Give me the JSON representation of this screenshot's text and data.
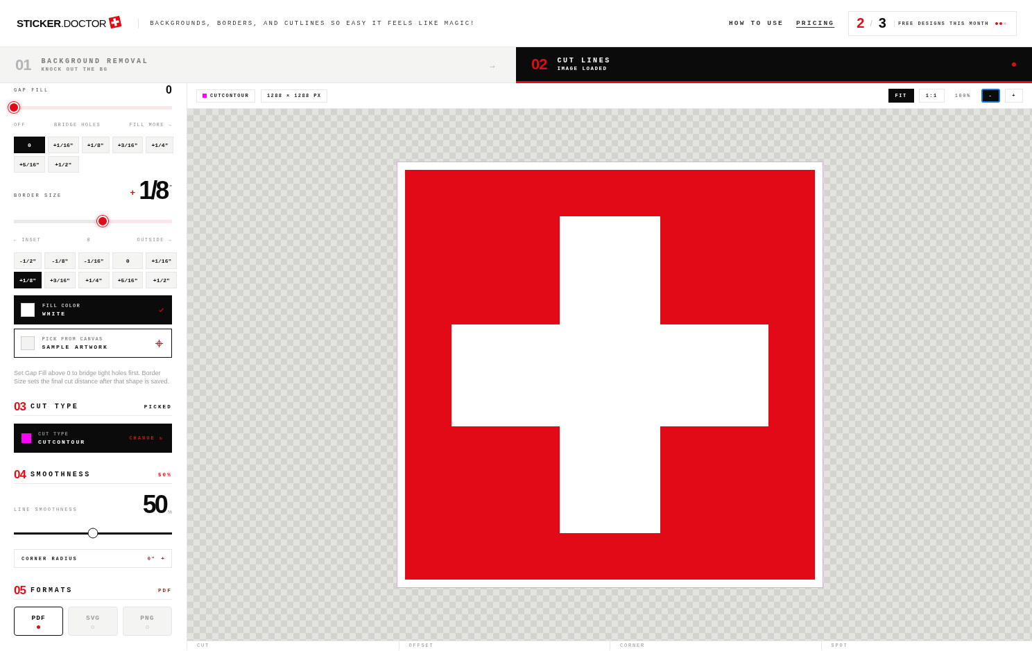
{
  "header": {
    "logo": "**STICKER**.DOCTOR",
    "tagline": "BACKGROUNDS, BORDERS, AND CUTLINES SO EASY IT FEELS LIKE MAGIC!",
    "nav": [
      {
        "label": "HOW TO USE",
        "underlined": false
      },
      {
        "label": "PRICING",
        "underlined": true
      }
    ],
    "quota": {
      "used": "2",
      "separator": "/",
      "total": "3",
      "label": "FREE DESIGNS THIS MONTH",
      "dots": [
        {
          "filled": true
        },
        {
          "filled": true
        },
        {
          "filled": false
        }
      ]
    }
  },
  "steps": [
    {
      "number": "01",
      "title": "BACKGROUND REMOVAL",
      "subtitle": "KNOCK OUT THE BG",
      "arrow": "→",
      "selected": false
    },
    {
      "number": "02",
      "title": "CUT LINES",
      "subtitle": "IMAGE LOADED",
      "selected": true
    }
  ],
  "sidebar": {
    "gap_fill": {
      "label": "GAP FILL",
      "value": "0",
      "level": 0,
      "scale": [
        "OFF",
        "BRIDGE HOLES",
        "FILL MORE →"
      ],
      "presets": [
        {
          "label": "0",
          "selected": true
        },
        {
          "label": "+1/16\"",
          "selected": false
        },
        {
          "label": "+1/8\"",
          "selected": false
        },
        {
          "label": "+3/16\"",
          "selected": false
        },
        {
          "label": "+1/4\"",
          "selected": false
        },
        {
          "label": "+5/16\"",
          "selected": false
        },
        {
          "label": "+1/2\"",
          "selected": false
        }
      ]
    },
    "border_size": {
      "label": "BORDER SIZE",
      "sign": "+",
      "value": "1/8",
      "unit": "\"",
      "level": 0.56,
      "scale": [
        "← INSET",
        "0",
        "OUTSIDE →"
      ],
      "presets": [
        {
          "label": "-1/2\"",
          "selected": false
        },
        {
          "label": "-1/8\"",
          "selected": false
        },
        {
          "label": "-1/16\"",
          "selected": false
        },
        {
          "label": "0",
          "selected": false
        },
        {
          "label": "+1/16\"",
          "selected": false
        },
        {
          "label": "+1/8\"",
          "selected": true
        },
        {
          "label": "+3/16\"",
          "selected": false
        },
        {
          "label": "+1/4\"",
          "selected": false
        },
        {
          "label": "+5/16\"",
          "selected": false
        },
        {
          "label": "+1/2\"",
          "selected": false
        }
      ]
    },
    "colors": [
      {
        "kind": "fill",
        "caption": "FILL COLOR",
        "value": "WHITE",
        "color": "#ffffff",
        "selected": true
      },
      {
        "kind": "sample",
        "caption": "PICK FROM CANVAS",
        "value": "SAMPLE ARTWORK",
        "color": "#f3f3f1",
        "selected": false
      }
    ],
    "help": "Set Gap Fill above 0 to bridge tight holes first. Border Size sets the final cut distance after that shape is saved.",
    "cut_type": {
      "number": "03",
      "title": "CUT TYPE",
      "status": "PICKED",
      "accent": false,
      "caption": "CUT TYPE",
      "value": "CUTCONTOUR",
      "color": "#ff00ff",
      "action": "CHANGE ↻"
    },
    "smoothness": {
      "number": "04",
      "title": "SMOOTHNESS",
      "status": "50%",
      "accent": true,
      "label": "LINE SMOOTHNESS",
      "value": "50",
      "unit": "%",
      "level": 0.5,
      "corner_radius": {
        "label": "CORNER RADIUS",
        "value": "0\"",
        "action": "+"
      }
    },
    "formats": {
      "number": "05",
      "title": "FORMATS",
      "status": "PDF",
      "accent": true,
      "options": [
        {
          "label": "PDF",
          "selected": true
        },
        {
          "label": "SVG",
          "selected": false
        },
        {
          "label": "PNG",
          "selected": false
        }
      ]
    }
  },
  "canvas": {
    "chips": [
      {
        "kind": "cut",
        "label": "CUTCONTOUR",
        "color": "#ff00ff"
      },
      {
        "kind": "size",
        "label": "1288 × 1288 PX"
      }
    ],
    "zoom": [
      {
        "kind": "mode",
        "label": "FIT",
        "selected": true
      },
      {
        "kind": "mode",
        "label": "1:1",
        "selected": false
      },
      {
        "kind": "readout",
        "label": "100%"
      },
      {
        "kind": "step",
        "label": "-",
        "focused": true
      },
      {
        "kind": "step",
        "label": "+",
        "focused": false
      }
    ],
    "panels": [
      "CUT",
      "OFFSET",
      "CORNER",
      "SPOT"
    ]
  }
}
